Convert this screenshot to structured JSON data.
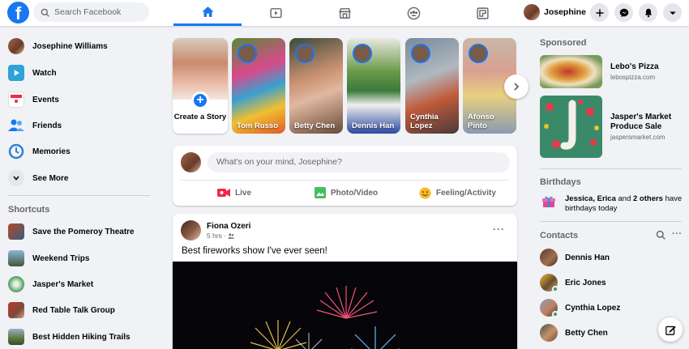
{
  "app": {
    "logo_letter": "f"
  },
  "search": {
    "placeholder": "Search Facebook"
  },
  "nav": {
    "tabs": [
      "home",
      "watch",
      "marketplace",
      "groups",
      "gaming"
    ]
  },
  "profile": {
    "name": "Josephine"
  },
  "sidebar": {
    "items": [
      {
        "label": "Josephine Williams",
        "icon": "avatar"
      },
      {
        "label": "Watch",
        "icon": "watch-icon"
      },
      {
        "label": "Events",
        "icon": "calendar-icon"
      },
      {
        "label": "Friends",
        "icon": "friends-icon"
      },
      {
        "label": "Memories",
        "icon": "clock-icon"
      },
      {
        "label": "See More",
        "icon": "chevron-down-icon"
      }
    ],
    "shortcuts_heading": "Shortcuts",
    "shortcuts": [
      {
        "label": "Save the Pomeroy Theatre"
      },
      {
        "label": "Weekend Trips"
      },
      {
        "label": "Jasper's Market"
      },
      {
        "label": "Red Table Talk Group"
      },
      {
        "label": "Best Hidden Hiking Trails"
      }
    ]
  },
  "stories": {
    "create_label": "Create a Story",
    "items": [
      {
        "name": "Tom Russo"
      },
      {
        "name": "Betty Chen"
      },
      {
        "name": "Dennis Han"
      },
      {
        "name": "Cynthia Lopez"
      },
      {
        "name": "Afonso Pinto"
      }
    ]
  },
  "composer": {
    "placeholder": "What's on your mind, Josephine?",
    "actions": [
      {
        "label": "Live",
        "color": "#f02849"
      },
      {
        "label": "Photo/Video",
        "color": "#45bd62"
      },
      {
        "label": "Feeling/Activity",
        "color": "#f7b928"
      }
    ]
  },
  "post": {
    "author": "Fiona Ozeri",
    "time": "5 hrs",
    "more": "···",
    "text": "Best fireworks show I've ever seen!"
  },
  "right": {
    "sponsored_heading": "Sponsored",
    "ads": [
      {
        "title": "Lebo's Pizza",
        "url": "lebospizza.com"
      },
      {
        "title": "Jasper's Market Produce Sale",
        "url": "jaspersmarket.com"
      }
    ],
    "birthdays_heading": "Birthdays",
    "birthday_text_bold": "Jessica, Erica",
    "birthday_text_mid": " and ",
    "birthday_text_bold2": "2 others",
    "birthday_text_end": " have birthdays today",
    "contacts_heading": "Contacts",
    "contacts": [
      {
        "name": "Dennis Han"
      },
      {
        "name": "Eric Jones"
      },
      {
        "name": "Cynthia Lopez"
      },
      {
        "name": "Betty Chen"
      }
    ]
  },
  "colors": {
    "brand": "#1877f2",
    "online": "#31a24c"
  }
}
